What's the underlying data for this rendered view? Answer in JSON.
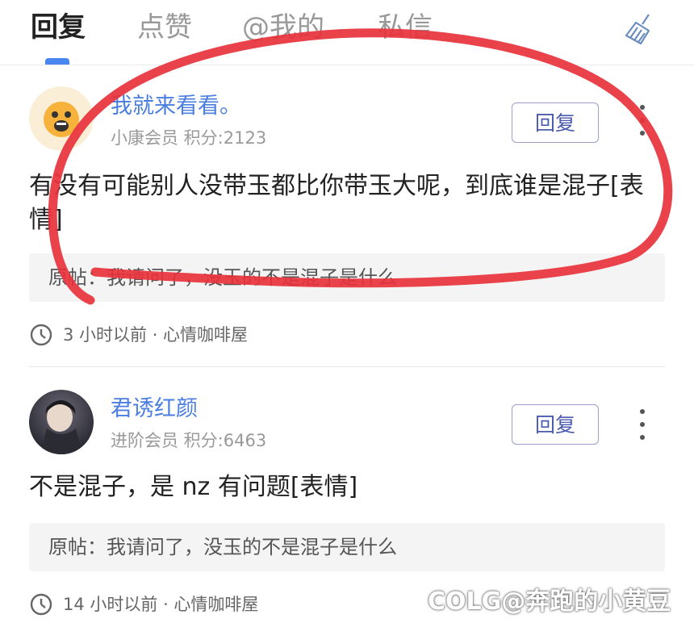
{
  "tabs": [
    {
      "label": "回复",
      "active": true
    },
    {
      "label": "点赞",
      "active": false
    },
    {
      "label": "@我的",
      "active": false
    },
    {
      "label": "私信",
      "active": false
    }
  ],
  "header": {
    "clear_icon": "broom-icon"
  },
  "posts": [
    {
      "username": "我就来看看。",
      "meta": "小康会员 积分:2123",
      "reply_label": "回复",
      "content": "有没有可能别人没带玉都比你带玉大呢，到底谁是混子[表情]",
      "original": "原帖：我请问了，没玉的不是混子是什么",
      "time": "3 小时以前 · 心情咖啡屋"
    },
    {
      "username": "君诱红颜",
      "meta": "进阶会员 积分:6463",
      "reply_label": "回复",
      "content": "不是混子，是 nz 有问题[表情]",
      "original": "原帖：我请问了，没玉的不是混子是什么",
      "time": "14 小时以前 · 心情咖啡屋"
    }
  ],
  "watermark": "COLG@奔跑的小黄豆",
  "colors": {
    "accent": "#4a7ee0",
    "annotation": "#e8323c",
    "tab_indicator": "#4a86f0"
  }
}
